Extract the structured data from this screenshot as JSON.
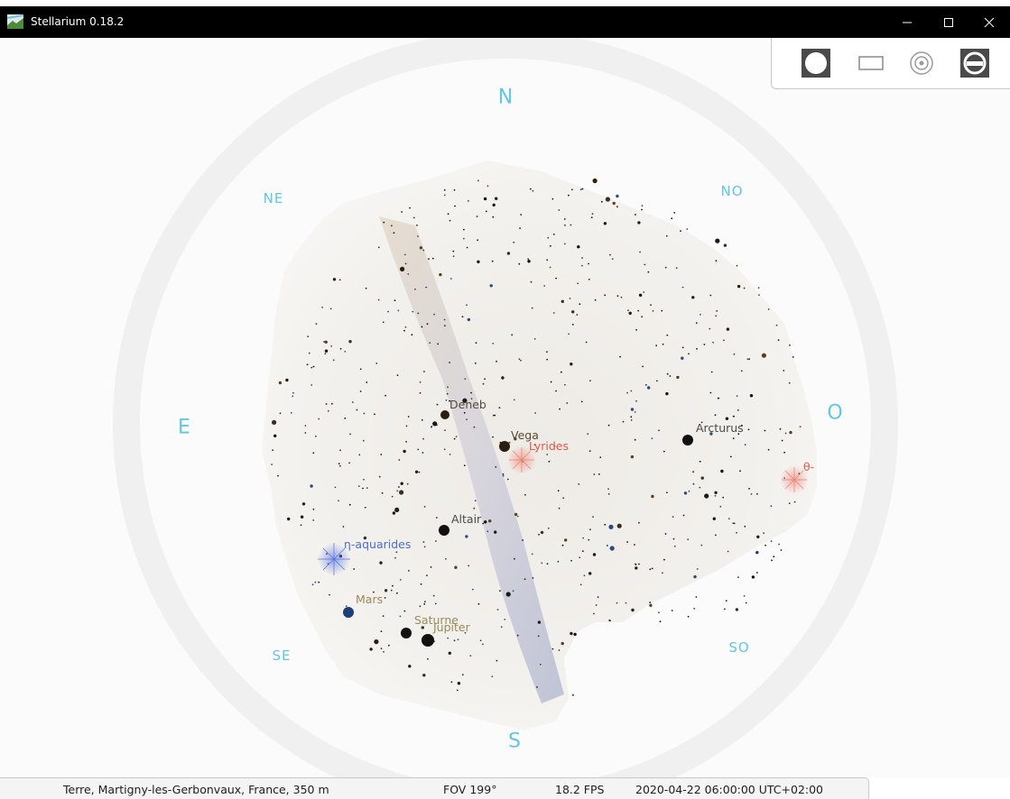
{
  "window": {
    "title": "Stellarium 0.18.2",
    "controls": [
      "minimize",
      "maximize",
      "close"
    ]
  },
  "toolbar": {
    "buttons": [
      {
        "name": "ground-toggle",
        "icon": "filled-circle-icon"
      },
      {
        "name": "window-mode",
        "icon": "rectangle-icon"
      },
      {
        "name": "target-view",
        "icon": "concentric-circles-icon"
      },
      {
        "name": "settings",
        "icon": "wrench-icon"
      }
    ]
  },
  "cardinals": {
    "n": "N",
    "ne": "NE",
    "no": "NO",
    "e": "E",
    "o": "O",
    "se": "SE",
    "so": "SO",
    "s": "S"
  },
  "objects": {
    "deneb": "Deneb",
    "vega": "Vega",
    "lyrides": "Lyrides",
    "arcturus": "Arcturus",
    "theta": "θ-",
    "altair": "Altair",
    "eta_aquarides": "η-aquarides",
    "mars": "Mars",
    "saturne": "Saturne",
    "jupiter": "Jupiter"
  },
  "colors": {
    "cardinal": "#63c6e3",
    "star_label": "#5a4a38",
    "meteor_shower": "#e05a4a",
    "aquarides": "#4a6fc8",
    "planet": "#9a8a5a"
  },
  "status": {
    "location": "Terre, Martigny-les-Gerbonvaux, France, 350 m",
    "fov": "FOV 199°",
    "fps": "18.2 FPS",
    "datetime": "2020-04-22 06:00:00 UTC+02:00"
  }
}
